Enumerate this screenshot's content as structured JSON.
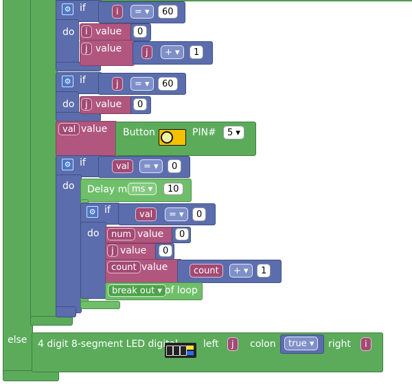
{
  "blocks": {
    "if_label": "if",
    "do_label": "do",
    "else_label": "else",
    "value_label": "value",
    "of_loop_label": "of loop",
    "if1": {
      "var": "i",
      "op": "=",
      "num": "60"
    },
    "do1_set_i": {
      "var": "i",
      "num": "0"
    },
    "do1_set_j": {
      "var": "j",
      "expr_var": "j",
      "op": "+",
      "num": "1"
    },
    "if2": {
      "var": "j",
      "op": "=",
      "num": "60"
    },
    "do2_set_j": {
      "var": "j",
      "num": "0"
    },
    "set_val": {
      "var": "val",
      "button_text": "Button",
      "pin_label": "PIN#",
      "pin_value": "5"
    },
    "if3": {
      "var": "val",
      "op": "=",
      "num": "0"
    },
    "delay": {
      "text": "Delay ms",
      "unit": "ms",
      "num": "10"
    },
    "if4": {
      "var": "val",
      "op": "=",
      "num": "0"
    },
    "do4_set_num": {
      "var": "num",
      "num": "0"
    },
    "do4_set_j": {
      "var": "j",
      "num": "0"
    },
    "do4_set_count": {
      "var": "count",
      "expr_var": "count",
      "op": "+",
      "num": "1"
    },
    "break": {
      "value": "break out"
    },
    "led": {
      "text": "4 digit 8-segment LED digital",
      "left_label": "left",
      "left_var": "j",
      "colon_label": "colon",
      "colon_value": "true",
      "right_label": "right",
      "right_var": "i"
    }
  },
  "colors": {
    "loop_green": "#5bab5b",
    "value_purple": "#b0567f",
    "logic_blue": "#5b6dac"
  }
}
